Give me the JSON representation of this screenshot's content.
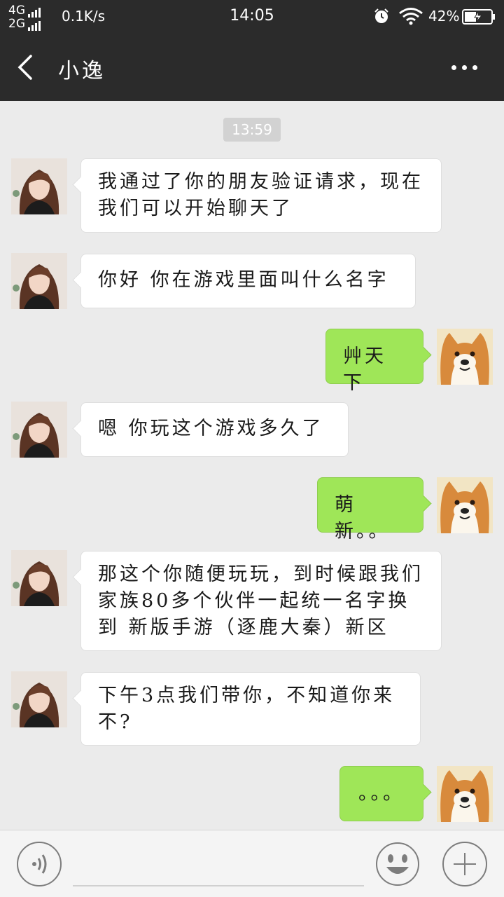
{
  "status_bar": {
    "net_top": "4G",
    "net_bottom": "2G",
    "speed": "0.1K/s",
    "time": "14:05",
    "battery": "42%",
    "icons": [
      "signal-icon",
      "alarm-icon",
      "wifi-icon",
      "battery-charging-icon"
    ]
  },
  "header": {
    "title": "小逸",
    "back_icon": "chevron-left-icon",
    "more_icon": "more-dots-icon"
  },
  "chat": {
    "timestamp": "13:59",
    "messages": [
      {
        "side": "in",
        "text": "我通过了你的朋友验证请求，现在我们可以开始聊天了"
      },
      {
        "side": "in",
        "text": "你好  你在游戏里面叫什么名字"
      },
      {
        "side": "out",
        "text": "艸天下"
      },
      {
        "side": "in",
        "text": "嗯  你玩这个游戏多久了"
      },
      {
        "side": "out",
        "text": "萌新。。"
      },
      {
        "side": "in",
        "text": "那这个你随便玩玩，到时候跟我们家族80多个伙伴一起统一名字换到 新版手游（逐鹿大秦）新区"
      },
      {
        "side": "in",
        "text": "下午3点我们带你，不知道你来不?"
      },
      {
        "side": "out",
        "text": "。。。"
      }
    ]
  },
  "input_bar": {
    "voice_icon": "voice-icon",
    "emoji_icon": "emoji-icon",
    "plus_icon": "plus-icon"
  },
  "colors": {
    "header_bg": "#2b2b2b",
    "chat_bg": "#ebebeb",
    "out_bubble": "#9fe658",
    "in_bubble": "#ffffff"
  }
}
